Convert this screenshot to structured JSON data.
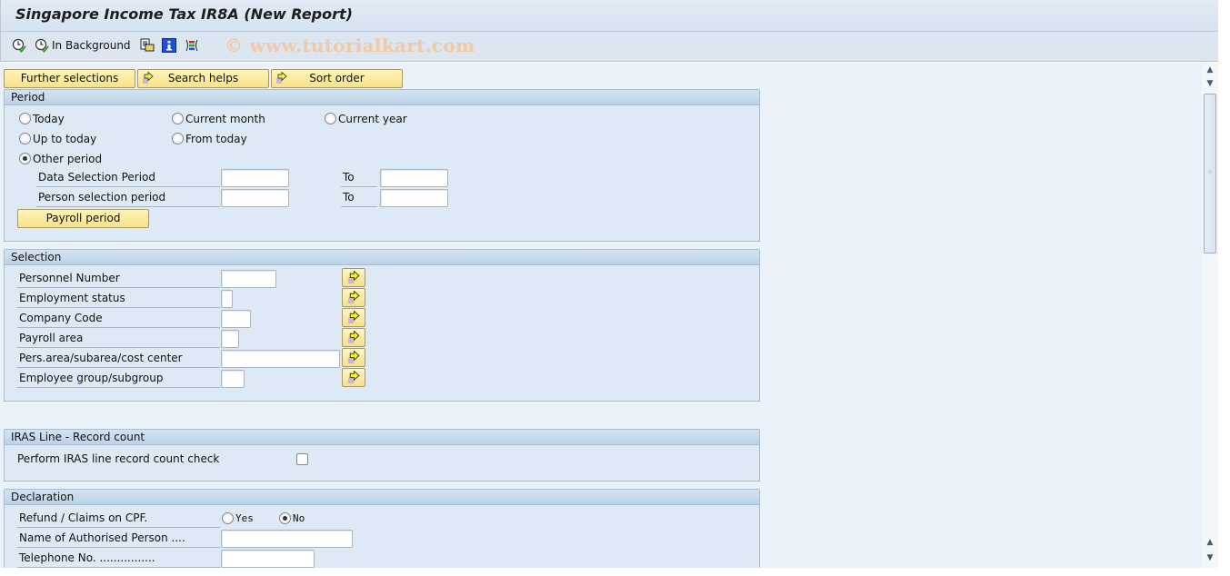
{
  "window": {
    "title": "Singapore Income Tax IR8A (New Report)",
    "watermark": "© www.tutorialkart.com"
  },
  "toolbar": {
    "items": [
      {
        "icon": "execute-icon",
        "label": ""
      },
      {
        "icon": "execute-background-icon",
        "label": "In Background"
      },
      {
        "icon": "get-variant-icon",
        "label": ""
      },
      {
        "icon": "program-documentation-icon",
        "label": ""
      },
      {
        "icon": "selection-screen-options-icon",
        "label": ""
      }
    ]
  },
  "top_buttons": {
    "further_selections": "Further selections",
    "search_helps": "Search helps",
    "sort_order": "Sort order"
  },
  "period": {
    "title": "Period",
    "radios": [
      {
        "label": "Today",
        "selected": false
      },
      {
        "label": "Current month",
        "selected": false
      },
      {
        "label": "Current year",
        "selected": false
      },
      {
        "label": "Up to today",
        "selected": false
      },
      {
        "label": "From today",
        "selected": false
      },
      {
        "label": "Other period",
        "selected": true
      }
    ],
    "data_selection_label": "Data Selection Period",
    "data_selection_from": "",
    "data_selection_to": "",
    "person_selection_label": "Person selection period",
    "person_selection_from": "",
    "person_selection_to": "",
    "to_label": "To",
    "payroll_period_button": "Payroll period"
  },
  "selection": {
    "title": "Selection",
    "fields": [
      {
        "label": "Personnel Number",
        "value": ""
      },
      {
        "label": "Employment status",
        "value": ""
      },
      {
        "label": "Company Code",
        "value": ""
      },
      {
        "label": "Payroll area",
        "value": ""
      },
      {
        "label": "Pers.area/subarea/cost center",
        "value": ""
      },
      {
        "label": "Employee group/subgroup",
        "value": ""
      }
    ]
  },
  "iras": {
    "title": "IRAS Line - Record count",
    "check_label": "Perform IRAS line  record count check",
    "checked": false
  },
  "declaration": {
    "title": "Declaration",
    "refund_label": "Refund / Claims on CPF.",
    "yes_label": "Yes",
    "no_label": "No",
    "refund_selected": "No",
    "authorised_person_label": "Name of Authorised Person ....",
    "authorised_person_value": "",
    "telephone_label": "Telephone No. ................",
    "telephone_value": ""
  }
}
